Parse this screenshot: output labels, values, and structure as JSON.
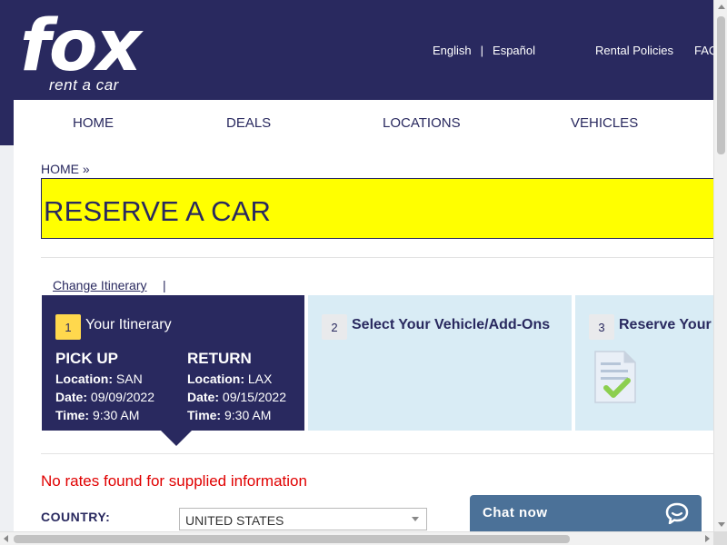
{
  "brand": {
    "logo_main": "fox",
    "logo_sub": "rent a car"
  },
  "top_links": {
    "english": "English",
    "separator": "|",
    "espanol": "Español",
    "rental_policies": "Rental Policies",
    "faq": "FAQ"
  },
  "nav": {
    "home": "HOME",
    "deals": "DEALS",
    "locations": "LOCATIONS",
    "vehicles": "VEHICLES"
  },
  "breadcrumb": {
    "home": "HOME",
    "sep": "»"
  },
  "page_title": "RESERVE A CAR",
  "itinerary_bar": {
    "change_link": "Change Itinerary",
    "pipe": "|"
  },
  "steps": [
    {
      "number": "1",
      "title": "Your Itinerary"
    },
    {
      "number": "2",
      "title": "Select Your Vehicle/Add-Ons"
    },
    {
      "number": "3",
      "title": "Reserve Your Vehicle"
    }
  ],
  "pickup": {
    "heading": "PICK UP",
    "location_label": "Location:",
    "location": "SAN",
    "date_label": "Date:",
    "date": "09/09/2022",
    "time_label": "Time:",
    "time": "9:30 AM"
  },
  "return": {
    "heading": "RETURN",
    "location_label": "Location:",
    "location": "LAX",
    "date_label": "Date:",
    "date": "09/15/2022",
    "time_label": "Time:",
    "time": "9:30 AM"
  },
  "error_message": "No rates found for supplied information",
  "country": {
    "label": "COUNTRY:",
    "selected": "UNITED STATES"
  },
  "chat": {
    "label": "Chat now"
  },
  "colors": {
    "brand_navy": "#29295f",
    "title_yellow": "#ffff00",
    "error_red": "#e00000",
    "step_light": "#d9ecf5",
    "chat_blue": "#4b7198"
  }
}
